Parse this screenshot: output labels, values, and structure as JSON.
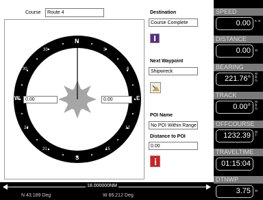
{
  "course": {
    "label": "Course",
    "value": "Route 4"
  },
  "destination": {
    "label": "Destination",
    "value": "Course Complete"
  },
  "next_waypoint": {
    "label": "Next Waypoint",
    "value": "Shipwreck"
  },
  "poi": {
    "label": "POI Name",
    "value": "No POI Within Range",
    "distance_label": "Distance to POI",
    "distance_value": "0.00"
  },
  "compass": {
    "north": "N",
    "south": "S",
    "east": "E",
    "west": "W",
    "ticks": {
      "n3": "3",
      "n6": "6",
      "n12": "12",
      "n15": "15",
      "n21": "21",
      "n24": "24",
      "n30": "30",
      "n33": "33"
    },
    "left_value": "0.00",
    "right_value": "0.00"
  },
  "bottom": {
    "distance": "18.000000NM",
    "lat": "N 43.189 Deg",
    "lon": "W 86.212 Deg"
  },
  "panel": {
    "speed": {
      "label": "SPEED",
      "value": "0.00",
      "unit": "K\nN"
    },
    "distance": {
      "label": "DISTANCE",
      "value": "0.00",
      "unit": "M"
    },
    "bearing": {
      "label": "BEARING",
      "value": "221.76°",
      "unit": "M\nA\nG"
    },
    "track": {
      "label": "TRACK",
      "value": "0.00°",
      "unit": "M\nA\nG"
    },
    "offcourse": {
      "label": "OFFCOURSE",
      "value": "1232.39",
      "unit": "M\nT"
    },
    "traveltime": {
      "label": "TRAVELTIME",
      "value": "01:15:04",
      "unit": ""
    },
    "dtnwp": {
      "label": "DTNWP",
      "value": "3.75",
      "unit": "M"
    }
  },
  "colors": {
    "compass_ring": "#000000",
    "sun": "#a6a6a6",
    "panel_bg": "#000000",
    "panel_header": "#7a7a7a",
    "info_icon": "#d81e1e",
    "flag_icon": "#5a2e86"
  }
}
